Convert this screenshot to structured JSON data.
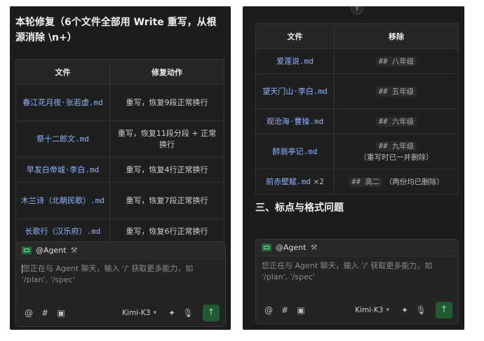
{
  "left": {
    "heading": "本轮修复（6个文件全部用 Write 重写，从根源消除 \\n+）",
    "headers": [
      "文件",
      "修复动作"
    ],
    "rows": [
      {
        "file": "春江花月夜·张若虚.md",
        "action": "重写，恢复9段正常换行"
      },
      {
        "file": "祭十二郎文.md",
        "action": "重写，恢复11段分段 + 正常换行"
      },
      {
        "file": "早发白帝城·李白.md",
        "action": "重写，恢复4行正常换行"
      },
      {
        "file": "木兰诗（北朝民歌）.md",
        "action": "重写，恢复7段正常换行"
      },
      {
        "file": "长歌行（汉乐府）.md",
        "action": "重写，恢复6行正常换行"
      }
    ]
  },
  "right": {
    "headers": [
      "文件",
      "移除"
    ],
    "rows": [
      {
        "file": "爱莲说.md",
        "remove_code": "## 八年级",
        "remove_note": ""
      },
      {
        "file": "望天门山·李白.md",
        "remove_code": "## 五年级",
        "remove_note": ""
      },
      {
        "file": "观沧海·曹操.md",
        "remove_code": "## 六年级",
        "remove_note": ""
      },
      {
        "file": "醉翁亭记.md",
        "remove_code": "## 九年级",
        "remove_note": "（重写时已一并删除）"
      },
      {
        "file": "前赤壁赋.md",
        "file_suffix": "×2",
        "remove_code": "## 高二",
        "remove_note": "（两份均已删除）"
      }
    ],
    "section_heading": "三、标点与格式问题",
    "scroll_icon": "arrow-up-icon"
  },
  "composer": {
    "agent_label": "@Agent",
    "placeholder": "您正在与 Agent 聊天，输入 '/' 获取更多能力，如 '/plan', '/spec'",
    "model": "Kimi-K3",
    "icons": [
      "at-icon",
      "hash-icon",
      "image-icon",
      "sparkle-icon",
      "mic-icon",
      "send-icon"
    ]
  }
}
